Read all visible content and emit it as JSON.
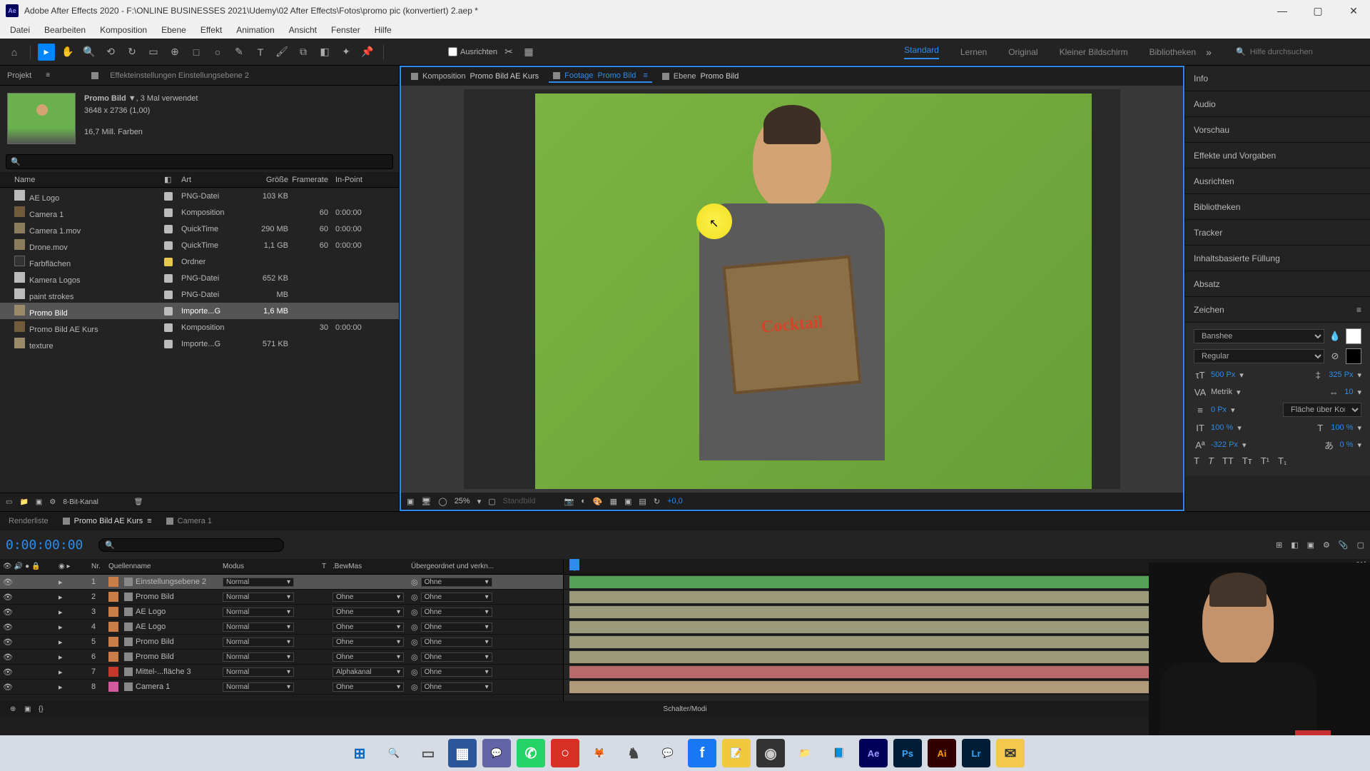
{
  "titlebar": {
    "app": "Adobe After Effects 2020",
    "path": "F:\\ONLINE BUSINESSES 2021\\Udemy\\02 After Effects\\Fotos\\promo pic (konvertiert) 2.aep *"
  },
  "menu": [
    "Datei",
    "Bearbeiten",
    "Komposition",
    "Ebene",
    "Effekt",
    "Animation",
    "Ansicht",
    "Fenster",
    "Hilfe"
  ],
  "toolbar": {
    "ausrichten": "Ausrichten",
    "workspaces": [
      "Standard",
      "Lernen",
      "Original",
      "Kleiner Bildschirm",
      "Bibliotheken"
    ],
    "active_workspace": 0,
    "search_placeholder": "Hilfe durchsuchen"
  },
  "project_panel": {
    "tab_main": "Projekt",
    "tab_sub": "Effekteinstellungen Einstellungsebene 2",
    "asset": {
      "name": "Promo Bild",
      "used": ", 3 Mal verwendet",
      "dims": "3648 x 2736 (1,00)",
      "colors": "16,7 Mill. Farben"
    },
    "columns": {
      "name": "Name",
      "type": "Art",
      "size": "Größe",
      "fps": "Framerate",
      "in": "In-Point"
    },
    "rows": [
      {
        "name": "AE Logo",
        "icon": "png",
        "label": "#bbb",
        "type": "PNG-Datei",
        "size": "103 KB",
        "fps": "",
        "in": ""
      },
      {
        "name": "Camera 1",
        "icon": "comp",
        "label": "#bbb",
        "type": "Komposition",
        "size": "",
        "fps": "60",
        "in": "0:00:00"
      },
      {
        "name": "Camera 1.mov",
        "icon": "mov",
        "label": "#bbb",
        "type": "QuickTime",
        "size": "290 MB",
        "fps": "60",
        "in": "0:00:00"
      },
      {
        "name": "Drone.mov",
        "icon": "mov",
        "label": "#bbb",
        "type": "QuickTime",
        "size": "1,1 GB",
        "fps": "60",
        "in": "0:00:00"
      },
      {
        "name": "Farbflächen",
        "icon": "folder",
        "label": "#e6c84d",
        "type": "Ordner",
        "size": "",
        "fps": "",
        "in": ""
      },
      {
        "name": "Kamera Logos",
        "icon": "png",
        "label": "#bbb",
        "type": "PNG-Datei",
        "size": "652 KB",
        "fps": "",
        "in": ""
      },
      {
        "name": "paint strokes",
        "icon": "png",
        "label": "#bbb",
        "type": "PNG-Datei",
        "size": "MB",
        "fps": "",
        "in": ""
      },
      {
        "name": "Promo Bild",
        "icon": "imp",
        "label": "#bbb",
        "type": "Importe...G",
        "size": "1,6 MB",
        "fps": "",
        "in": "",
        "selected": true
      },
      {
        "name": "Promo Bild AE Kurs",
        "icon": "comp",
        "label": "#bbb",
        "type": "Komposition",
        "size": "",
        "fps": "30",
        "in": "0:00:00"
      },
      {
        "name": "texture",
        "icon": "imp",
        "label": "#bbb",
        "type": "Importe...G",
        "size": "571 KB",
        "fps": "",
        "in": ""
      }
    ],
    "footer_depth": "8-Bit-Kanal"
  },
  "viewer": {
    "tabs": [
      {
        "prefix": "Komposition",
        "name": "Promo Bild AE Kurs"
      },
      {
        "prefix": "Footage",
        "name": "Promo Bild",
        "active": true
      },
      {
        "prefix": "Ebene",
        "name": "Promo Bild"
      }
    ],
    "zoom": "25%",
    "standbild": "Standbild",
    "offset": "+0,0",
    "sign_text": "Cocktail"
  },
  "right_panel": {
    "sections": [
      "Info",
      "Audio",
      "Vorschau",
      "Effekte und Vorgaben",
      "Ausrichten",
      "Bibliotheken",
      "Tracker",
      "Inhaltsbasierte Füllung",
      "Absatz",
      "Zeichen"
    ],
    "char": {
      "font": "Banshee",
      "style": "Regular",
      "size_label": "500",
      "size_unit": "Px",
      "leading": "325",
      "leading_unit": "Px",
      "kerning": "Metrik",
      "tracking": "10",
      "stroke": "0",
      "stroke_unit": "Px",
      "fill_mode": "Fläche über Kon...",
      "hscale": "100",
      "pct": "%",
      "vscale": "100",
      "baseline": "-322",
      "baseline_unit": "Px",
      "tsume": "0"
    }
  },
  "timeline": {
    "tabs": [
      "Renderliste",
      "Promo Bild AE Kurs",
      "Camera 1"
    ],
    "active_tab": 1,
    "timecode": "0:00:00:00",
    "header": {
      "nr": "Nr.",
      "name": "Quellenname",
      "mode": "Modus",
      "t": "T",
      "bew": ".BewMas",
      "parent": "Übergeordnet und verkn..."
    },
    "layers": [
      {
        "nr": "1",
        "color": "#c97e4a",
        "name": "Einstellungsebene 2",
        "mode": "Normal",
        "bew": "",
        "parent": "Ohne",
        "bar": "#55a055",
        "selected": true
      },
      {
        "nr": "2",
        "color": "#c97e4a",
        "name": "Promo Bild",
        "mode": "Normal",
        "bew": "Ohne",
        "parent": "Ohne",
        "bar": "#9a9a7a"
      },
      {
        "nr": "3",
        "color": "#c97e4a",
        "name": "AE Logo",
        "mode": "Normal",
        "bew": "Ohne",
        "parent": "Ohne",
        "bar": "#9a9a7a"
      },
      {
        "nr": "4",
        "color": "#c97e4a",
        "name": "AE Logo",
        "mode": "Normal",
        "bew": "Ohne",
        "parent": "Ohne",
        "bar": "#9a9a7a"
      },
      {
        "nr": "5",
        "color": "#c97e4a",
        "name": "Promo Bild",
        "mode": "Normal",
        "bew": "Ohne",
        "parent": "Ohne",
        "bar": "#9a9a7a"
      },
      {
        "nr": "6",
        "color": "#c97e4a",
        "name": "Promo Bild",
        "mode": "Normal",
        "bew": "Ohne",
        "parent": "Ohne",
        "bar": "#9a9a7a"
      },
      {
        "nr": "7",
        "color": "#c0392b",
        "name": "Mittel-...fläche 3",
        "mode": "Normal",
        "bew": "Alphakanal",
        "parent": "Ohne",
        "bar": "#b86a6a"
      },
      {
        "nr": "8",
        "color": "#d45aa0",
        "name": "Camera 1",
        "mode": "Normal",
        "bew": "Ohne",
        "parent": "Ohne",
        "bar": "#b09a7a"
      }
    ],
    "ruler_end": "01f",
    "footer": "Schalter/Modi"
  },
  "taskbar": {
    "icons": [
      {
        "name": "start",
        "glyph": "⊞",
        "bg": "",
        "fg": "#0067c0"
      },
      {
        "name": "search",
        "glyph": "🔍",
        "bg": "",
        "fg": "#333"
      },
      {
        "name": "taskview",
        "glyph": "▭",
        "bg": "",
        "fg": "#555"
      },
      {
        "name": "widget1",
        "glyph": "▦",
        "bg": "#2b579a",
        "fg": "#fff"
      },
      {
        "name": "teams",
        "glyph": "💬",
        "bg": "#6264a7",
        "fg": "#fff"
      },
      {
        "name": "whatsapp",
        "glyph": "✆",
        "bg": "#25d366",
        "fg": "#fff"
      },
      {
        "name": "app-red",
        "glyph": "○",
        "bg": "#d93025",
        "fg": "#fff"
      },
      {
        "name": "firefox",
        "glyph": "🦊",
        "bg": "",
        "fg": ""
      },
      {
        "name": "app-gray",
        "glyph": "♞",
        "bg": "",
        "fg": "#444"
      },
      {
        "name": "messenger",
        "glyph": "💬",
        "bg": "",
        "fg": "#a033ff"
      },
      {
        "name": "facebook",
        "glyph": "f",
        "bg": "#1877f2",
        "fg": "#fff"
      },
      {
        "name": "notes",
        "glyph": "📝",
        "bg": "#f0c93e",
        "fg": ""
      },
      {
        "name": "obs",
        "glyph": "◉",
        "bg": "#333",
        "fg": "#ccc"
      },
      {
        "name": "explorer",
        "glyph": "📁",
        "bg": "",
        "fg": ""
      },
      {
        "name": "editor",
        "glyph": "📘",
        "bg": "",
        "fg": ""
      },
      {
        "name": "ae",
        "glyph": "Ae",
        "bg": "#00005b",
        "fg": "#9999ff"
      },
      {
        "name": "ps",
        "glyph": "Ps",
        "bg": "#001e36",
        "fg": "#31a8ff"
      },
      {
        "name": "ai",
        "glyph": "Ai",
        "bg": "#330000",
        "fg": "#ff9a00"
      },
      {
        "name": "lr",
        "glyph": "Lr",
        "bg": "#001e36",
        "fg": "#31a8ff"
      },
      {
        "name": "mail",
        "glyph": "✉",
        "bg": "#f2c94c",
        "fg": "#333"
      }
    ]
  }
}
